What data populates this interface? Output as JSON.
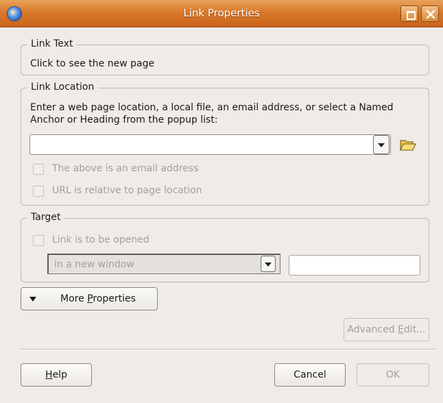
{
  "window": {
    "title": "Link Properties"
  },
  "link_text": {
    "group_label": "Link Text",
    "value": "Click to see the new page"
  },
  "link_location": {
    "group_label": "Link Location",
    "instructions_line1": "Enter a web page location, a local file, an email address, or select a Named",
    "instructions_line2": "Anchor or Heading from the popup list:",
    "url_value": "",
    "email_checkbox_label": "The above is an email address",
    "relative_checkbox_label": "URL is relative to page location"
  },
  "target": {
    "group_label": "Target",
    "open_checkbox_label": "Link is to be opened",
    "select_value": "in a new window",
    "name_value": ""
  },
  "buttons": {
    "more_properties_pre": "More ",
    "more_properties_key": "P",
    "more_properties_post": "roperties",
    "advanced_edit_pre": "Advanced ",
    "advanced_edit_key": "E",
    "advanced_edit_post": "dit...",
    "help_key": "H",
    "help_post": "elp",
    "cancel": "Cancel",
    "ok": "OK"
  }
}
